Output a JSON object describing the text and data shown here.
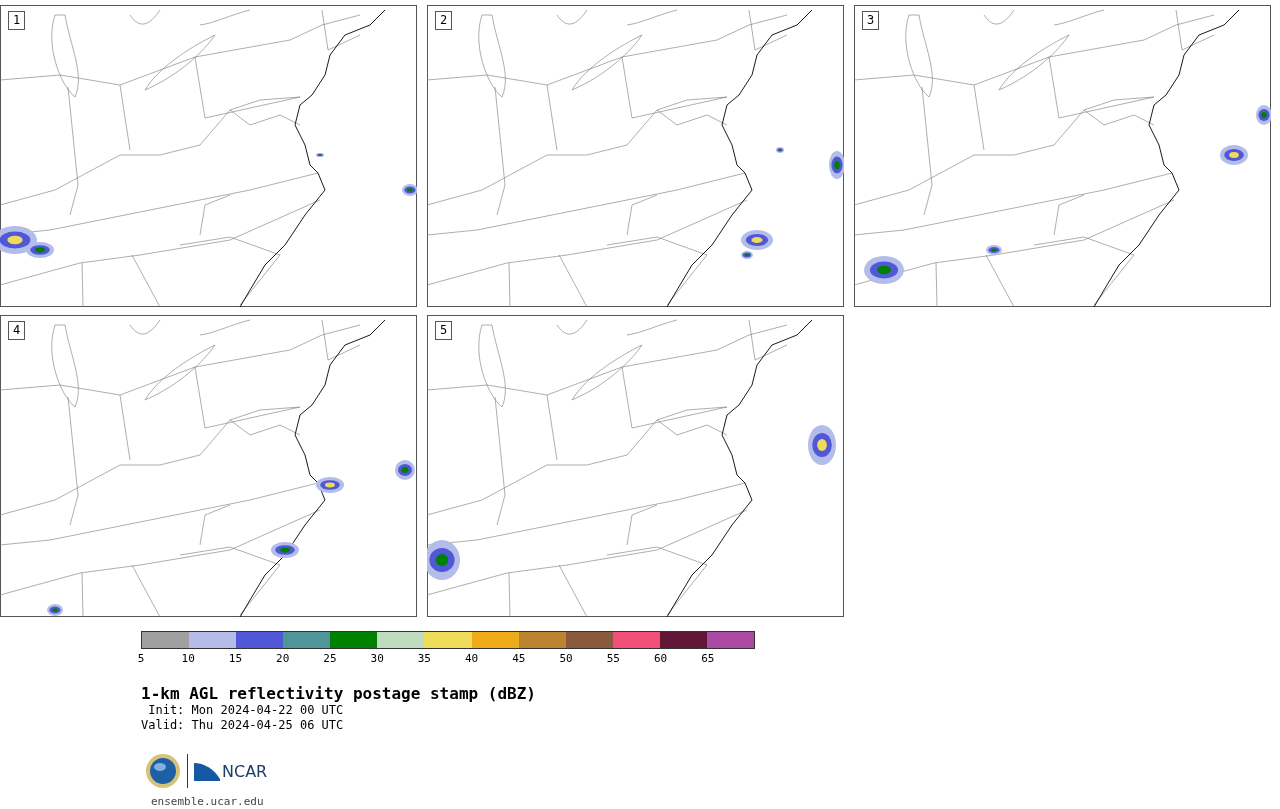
{
  "panels": [
    {
      "label": "1"
    },
    {
      "label": "2"
    },
    {
      "label": "3"
    },
    {
      "label": "4"
    },
    {
      "label": "5"
    }
  ],
  "colorbar": {
    "segments": [
      {
        "color": "#a0a0a0"
      },
      {
        "color": "#b4bdea"
      },
      {
        "color": "#5058d6"
      },
      {
        "color": "#4e9699"
      },
      {
        "color": "#008000"
      },
      {
        "color": "#bddbbd"
      },
      {
        "color": "#efdb5a"
      },
      {
        "color": "#eeaa18"
      },
      {
        "color": "#bb8230"
      },
      {
        "color": "#8a5a3e"
      },
      {
        "color": "#f24e78"
      },
      {
        "color": "#611733"
      },
      {
        "color": "#ab4aa2"
      }
    ],
    "ticks": [
      "5",
      "10",
      "15",
      "20",
      "25",
      "30",
      "35",
      "40",
      "45",
      "50",
      "55",
      "60",
      "65"
    ]
  },
  "title": "1-km AGL reflectivity postage stamp (dBZ)",
  "init": " Init: Mon 2024-04-22 00 UTC",
  "valid": "Valid: Thu 2024-04-25 06 UTC",
  "footer": {
    "logo_text": "NCAR",
    "url": "ensemble.ucar.edu"
  }
}
